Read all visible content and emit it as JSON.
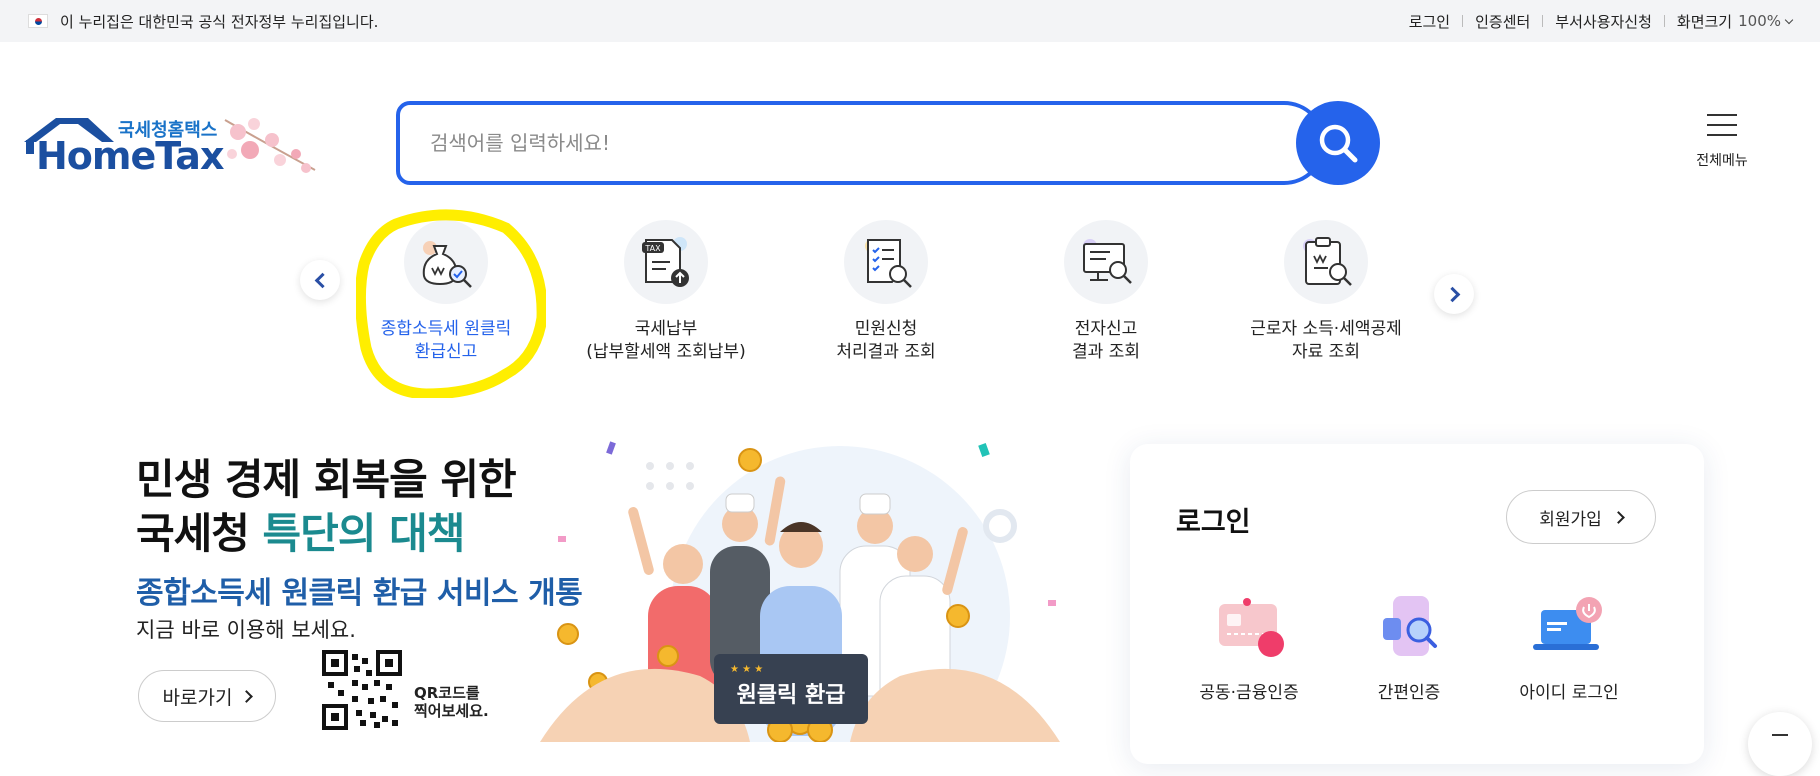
{
  "gov_banner": {
    "text": "이 누리집은 대한민국 공식 전자정부 누리집입니다.",
    "links": [
      "로그인",
      "인증센터",
      "부서사용자신청"
    ],
    "zoom_label": "화면크기",
    "zoom_value": "100%"
  },
  "header": {
    "logo_sub": "국세청홈택스",
    "logo_main": "HomeTax",
    "search_placeholder": "검색어를 입력하세요!",
    "menu_label": "전체메뉴"
  },
  "quick_menu": [
    {
      "line1": "종합소득세 원클릭",
      "line2": "환급신고",
      "icon": "money-bag-search-icon",
      "active": true
    },
    {
      "line1": "국세납부",
      "line2": "(납부할세액 조회납부)",
      "icon": "tax-document-upload-icon",
      "active": false
    },
    {
      "line1": "민원신청",
      "line2": "처리결과 조회",
      "icon": "checklist-search-icon",
      "active": false
    },
    {
      "line1": "전자신고",
      "line2": "결과 조회",
      "icon": "monitor-search-icon",
      "active": false
    },
    {
      "line1": "근로자 소득·세액공제",
      "line2": "자료 조회",
      "icon": "clipboard-search-icon",
      "active": false
    }
  ],
  "banner": {
    "title_line1": "민생 경제 회복을 위한",
    "title_line2_prefix": "국세청 ",
    "title_line2_accent": "특단의 대책",
    "subtitle": "종합소득세 원클릭 환급 서비스 개통",
    "description": "지금 바로 이용해 보세요.",
    "go_label": "바로가기",
    "qr_text_line1": "QR코드를",
    "qr_text_line2": "찍어보세요.",
    "illustration_sign": "원클릭 환급"
  },
  "login": {
    "title": "로그인",
    "join_label": "회원가입",
    "options": [
      {
        "label": "공동·금융인증",
        "icon": "certificate-card-icon"
      },
      {
        "label": "간편인증",
        "icon": "phone-search-icon"
      },
      {
        "label": "아이디 로그인",
        "icon": "laptop-power-icon"
      }
    ]
  },
  "colors": {
    "primary": "#2563eb",
    "highlight": "#ffee00",
    "accent_teal": "#1b8a8f",
    "subtitle_blue": "#1f5ea8"
  }
}
